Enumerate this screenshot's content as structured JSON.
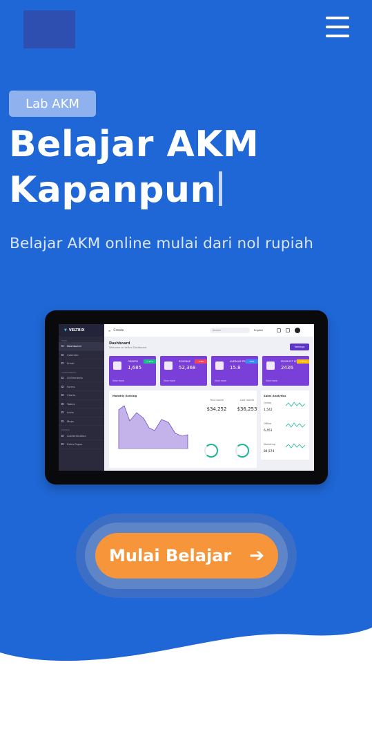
{
  "header": {
    "logo": "logo",
    "menu_icon": "hamburger-menu-icon"
  },
  "hero": {
    "badge": "Lab AKM",
    "title_line1": "Belajar AKM",
    "title_line2": "Kapanpun",
    "subtitle": "Belajar AKM online mulai dari nol rupiah"
  },
  "mockup": {
    "brand": "VELTRIX",
    "create": "Create",
    "search": "Search",
    "language": "English",
    "sidebar": [
      "Dashboard",
      "Calendar",
      "Email",
      "UI Elements",
      "Forms",
      "Charts",
      "Tables",
      "Icons",
      "Maps",
      "Authentication",
      "Extra Pages"
    ],
    "sections": [
      "MAIN",
      "COMPONENTS",
      "EXTRAS"
    ],
    "page_title": "Dashboard",
    "page_subtitle": "Welcome to Veltrix Dashboard",
    "settings": "Settings",
    "stats": [
      {
        "label": "ORDERS",
        "value": "1,685",
        "tag": "+ 12%"
      },
      {
        "label": "REVENUE",
        "value": "52,368",
        "tag": "- 28%"
      },
      {
        "label": "AVERAGE PRICE",
        "value": "15.8",
        "tag": "00%"
      },
      {
        "label": "PRODUCT SOLD",
        "value": "2436",
        "tag": "+ 84%"
      }
    ],
    "view_more": "View more",
    "monthly_title": "Monthly Earning",
    "this_month": "This month",
    "this_month_value": "$34,252",
    "last_month": "Last month",
    "last_month_value": "$36,253",
    "sales_title": "Sales Analytics",
    "sales": [
      {
        "label": "Online",
        "value": "1,542"
      },
      {
        "label": "Offline",
        "value": "6,451"
      },
      {
        "label": "Marketing",
        "value": "84,574"
      }
    ]
  },
  "cta": {
    "label": "Mulai Belajar",
    "arrow_icon": "arrow-right-icon"
  },
  "colors": {
    "background": "#1f67d6",
    "badge": "#8fb2ee",
    "cta": "#f7953a",
    "mockup_accent": "#7a3fd8"
  }
}
